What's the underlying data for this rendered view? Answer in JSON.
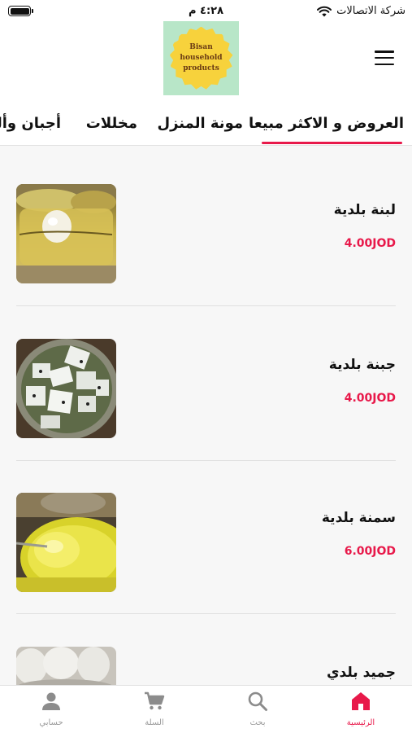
{
  "status_bar": {
    "carrier": "شركة الاتصالات",
    "time": "٤:٢٨ م"
  },
  "header": {
    "logo_lines": [
      "Bisan",
      "household",
      "products"
    ]
  },
  "tabs": [
    {
      "label": "العروض و الاكثر مبيعا",
      "active": true
    },
    {
      "label": "مونة المنزل",
      "active": false
    },
    {
      "label": "مخللات",
      "active": false
    },
    {
      "label": "أجبان وألبان",
      "active": false
    }
  ],
  "products": [
    {
      "name": "لبنة بلدية",
      "price": "4.00JOD"
    },
    {
      "name": "جبنة بلدية",
      "price": "4.00JOD"
    },
    {
      "name": "سمنة بلدية",
      "price": "6.00JOD"
    },
    {
      "name": "جميد بلدي",
      "price": ""
    }
  ],
  "bottom_nav": [
    {
      "label": "الرئيسية",
      "icon": "home-icon",
      "active": true
    },
    {
      "label": "بحث",
      "icon": "search-icon",
      "active": false
    },
    {
      "label": "السلة",
      "icon": "cart-icon",
      "active": false
    },
    {
      "label": "حسابي",
      "icon": "person-icon",
      "active": false
    }
  ],
  "colors": {
    "accent": "#e8194a",
    "logo_bg": "#b8e6c8",
    "logo_badge": "#f7d23c"
  }
}
